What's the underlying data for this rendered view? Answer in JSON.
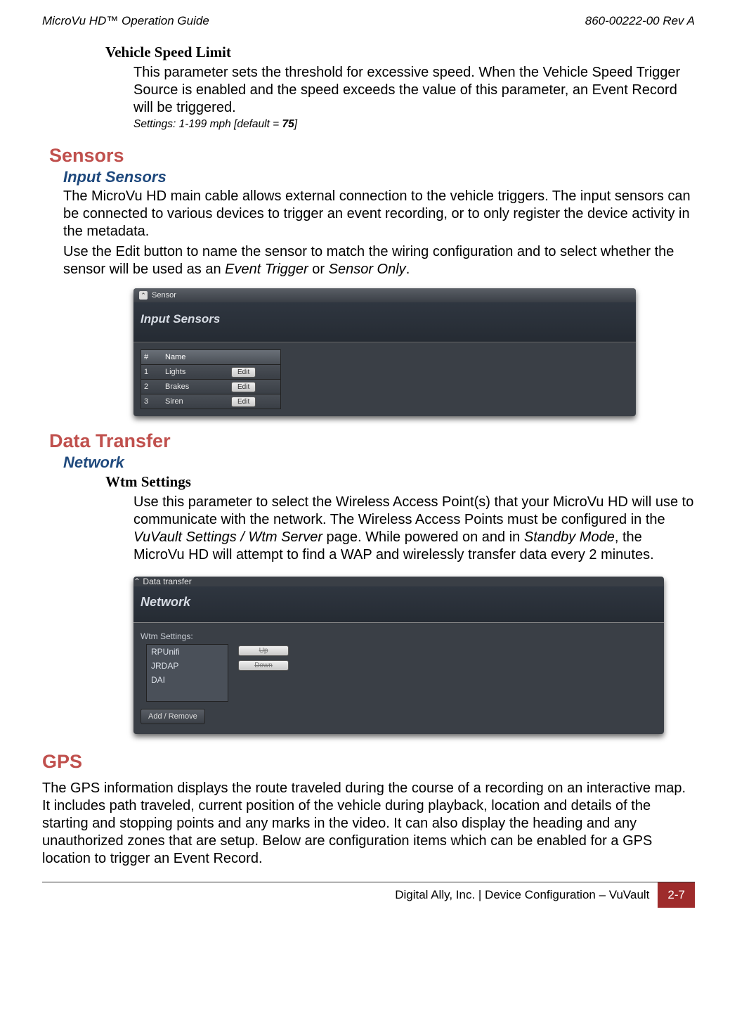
{
  "header": {
    "left": "MicroVu HD™ Operation Guide",
    "right": "860-00222-00 Rev A"
  },
  "vsl": {
    "title": "Vehicle Speed Limit",
    "body": "This parameter sets the threshold for excessive speed. When the Vehicle Speed Trigger Source is enabled and the speed exceeds the value of this parameter, an Event Record will be triggered.",
    "settings_prefix": "Settings: 1-199 mph [default = ",
    "settings_bold": "75",
    "settings_suffix": "]"
  },
  "sensors": {
    "h1": "Sensors",
    "h2": "Input Sensors",
    "p1": "The MicroVu HD main cable allows external connection to the vehicle triggers. The input sensors can be connected to various devices to trigger an event recording, or to only register the device activity in the metadata.",
    "p2a": "Use the Edit button to name the sensor to match the wiring configuration and to select whether the sensor will be used as an ",
    "p2i1": "Event Trigger",
    "p2mid": " or ",
    "p2i2": "Sensor Only",
    "p2end": ".",
    "ui": {
      "bar": "Sensor",
      "section": "Input Sensors",
      "cols": {
        "num": "#",
        "name": "Name"
      },
      "rows": [
        {
          "n": "1",
          "name": "Lights",
          "btn": "Edit"
        },
        {
          "n": "2",
          "name": "Brakes",
          "btn": "Edit"
        },
        {
          "n": "3",
          "name": "Siren",
          "btn": "Edit"
        }
      ]
    }
  },
  "dt": {
    "h1": "Data Transfer",
    "h2": "Network",
    "h4": "Wtm Settings",
    "p_a": "Use this parameter to select the Wireless Access Point(s) that your MicroVu HD will use to communicate with the network. The Wireless Access Points must be configured in the ",
    "p_i1": "VuVault Settings / Wtm Server",
    "p_b": " page. While powered on and in ",
    "p_i2": "Standby Mode",
    "p_c": ", the MicroVu HD will attempt to find a WAP and wirelessly transfer data every 2 minutes.",
    "ui": {
      "bar": "Data transfer",
      "section": "Network",
      "label": "Wtm Settings:",
      "list": [
        "RPUnifi",
        "JRDAP",
        "DAI"
      ],
      "up": "Up",
      "down": "Down",
      "addremove": "Add / Remove"
    }
  },
  "gps": {
    "h1": "GPS",
    "p": "The GPS information displays the route traveled during the course of a recording on an interactive map. It includes path traveled, current position of the vehicle during playback, location and details of the starting and stopping points and any marks in the video. It can also display the heading and any unauthorized zones that are setup. Below are configuration items which can be enabled for a GPS location to trigger an Event Record."
  },
  "footer": {
    "text": "Digital Ally, Inc. | Device Configuration – VuVault",
    "page": "2-7"
  }
}
